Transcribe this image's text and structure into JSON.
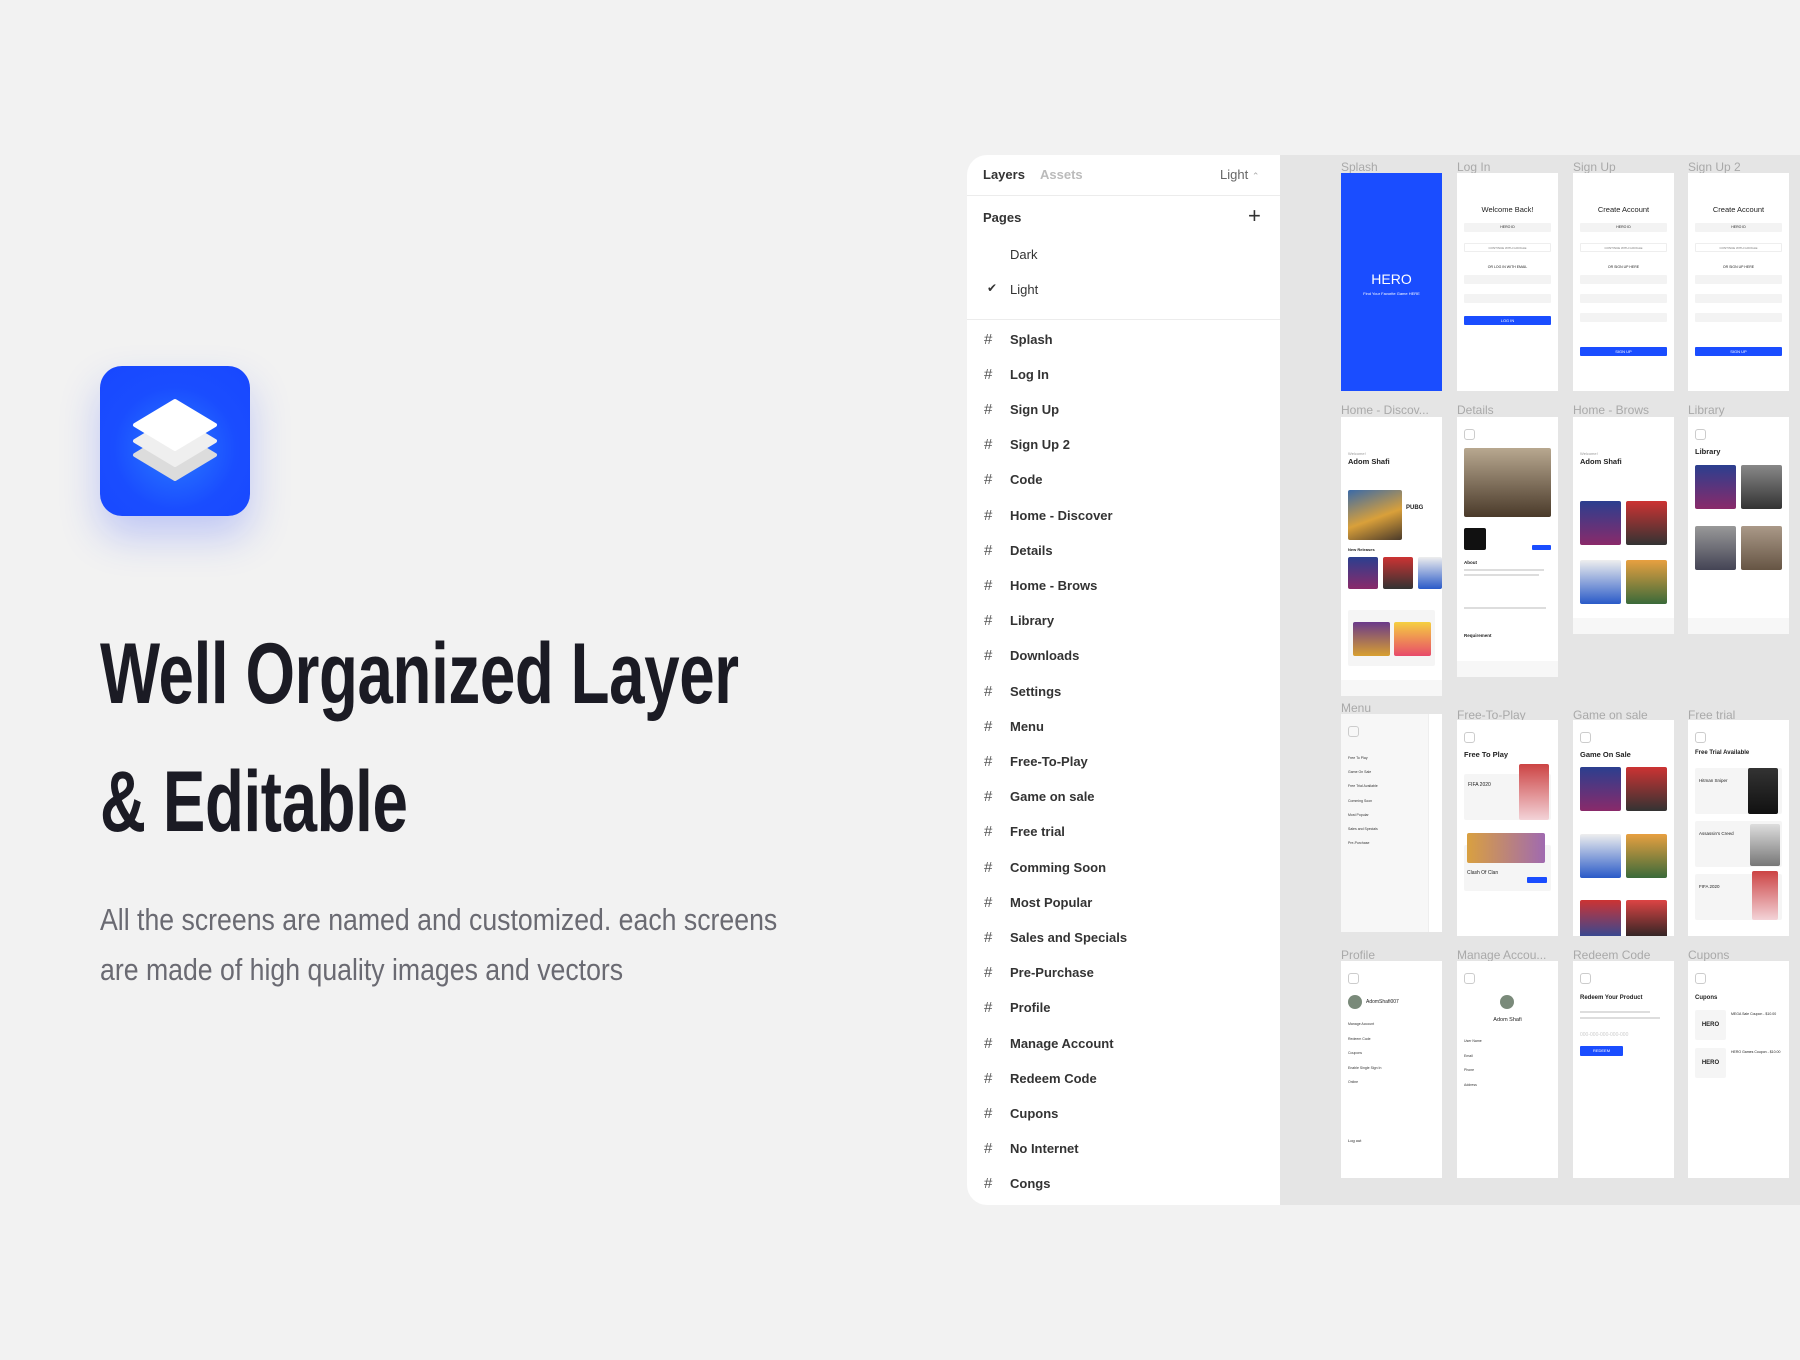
{
  "hero": {
    "title_line1": "Well Organized Layer",
    "title_line2": "& Editable",
    "subtitle_line1": "All the screens are named and customized. each screens",
    "subtitle_line2": "are made of high quality images and vectors",
    "icon": "layers-icon",
    "accent": "#1a4dff"
  },
  "panel": {
    "tabs": [
      "Layers",
      "Assets"
    ],
    "page_select": "Light",
    "pages_label": "Pages",
    "pages": [
      {
        "label": "Dark",
        "selected": false
      },
      {
        "label": "Light",
        "selected": true
      }
    ],
    "layers": [
      "Splash",
      "Log In",
      "Sign Up",
      "Sign Up 2",
      "Code",
      "Home - Discover",
      "Details",
      "Home - Brows",
      "Library",
      "Downloads",
      "Settings",
      "Menu",
      "Free-To-Play",
      "Game on sale",
      "Free trial",
      "Comming Soon",
      "Most Popular",
      "Sales and Specials",
      "Pre-Purchase",
      "Profile",
      "Manage Account",
      "Redeem Code",
      "Cupons",
      "No Internet",
      "Congs"
    ]
  },
  "canvas": {
    "artboard_labels": [
      "Splash",
      "Log In",
      "Sign Up",
      "Sign Up 2",
      "Home - Discov...",
      "Details",
      "Home - Brows",
      "Library",
      "Menu",
      "Free-To-Play",
      "Game on sale",
      "Free trial",
      "Profile",
      "Manage Accou...",
      "Redeem Code",
      "Cupons"
    ],
    "splash": {
      "logo": "HERO",
      "tagline": "Find Your Favorite Game HERE"
    },
    "login": {
      "heading": "Welcome Back!",
      "hero_id": "HERO ID",
      "google": "CONTINUE WITH GOOGLE",
      "or": "OR LOG IN WITH EMAIL",
      "button": "LOG IN"
    },
    "signup": {
      "heading": "Create Account",
      "hero_id": "HERO ID",
      "google": "CONTINUE WITH GOOGLE",
      "or": "OR SIGN UP HERE",
      "button": "SIGN UP"
    },
    "home": {
      "welcome": "Welcome!",
      "name": "Adom Shafi",
      "featured": "PUBG",
      "section": "New Releases"
    },
    "details": {
      "about": "About",
      "requirement": "Requirement"
    },
    "library": {
      "heading": "Library"
    },
    "menu": {
      "items": [
        "Free To Play",
        "Game On Sale",
        "Free Trial Available",
        "Comming Soon",
        "Most Popular",
        "Sales and Specials",
        "Pre-Purchase"
      ]
    },
    "free_to_play": {
      "heading": "Free To Play",
      "games": [
        "FIFA 2020",
        "Clash Of Clan"
      ]
    },
    "game_on_sale": {
      "heading": "Game On Sale"
    },
    "free_trial": {
      "heading": "Free Trial Available",
      "games": [
        "Hitman Sniper",
        "Assassin's Creed",
        "FIFA 2020"
      ]
    },
    "profile": {
      "username": "AdomShafi007",
      "items": [
        "Manage Account",
        "Redeem Code",
        "Coupons",
        "Enable Single Sign In",
        "Online"
      ],
      "logout": "Log out"
    },
    "manage": {
      "name": "Adom Shafi",
      "fields": [
        "User Name",
        "Email",
        "Phone",
        "Address"
      ]
    },
    "redeem": {
      "heading": "Redeem Your Product",
      "placeholder": "000-000-000-000-000",
      "button": "REDEEM"
    },
    "cupons": {
      "heading": "Cupons",
      "brand": "HERO",
      "coupons": [
        "MEGA Sale Coupon - $10.00",
        "HERO Games Coupon - $10.00"
      ]
    }
  }
}
